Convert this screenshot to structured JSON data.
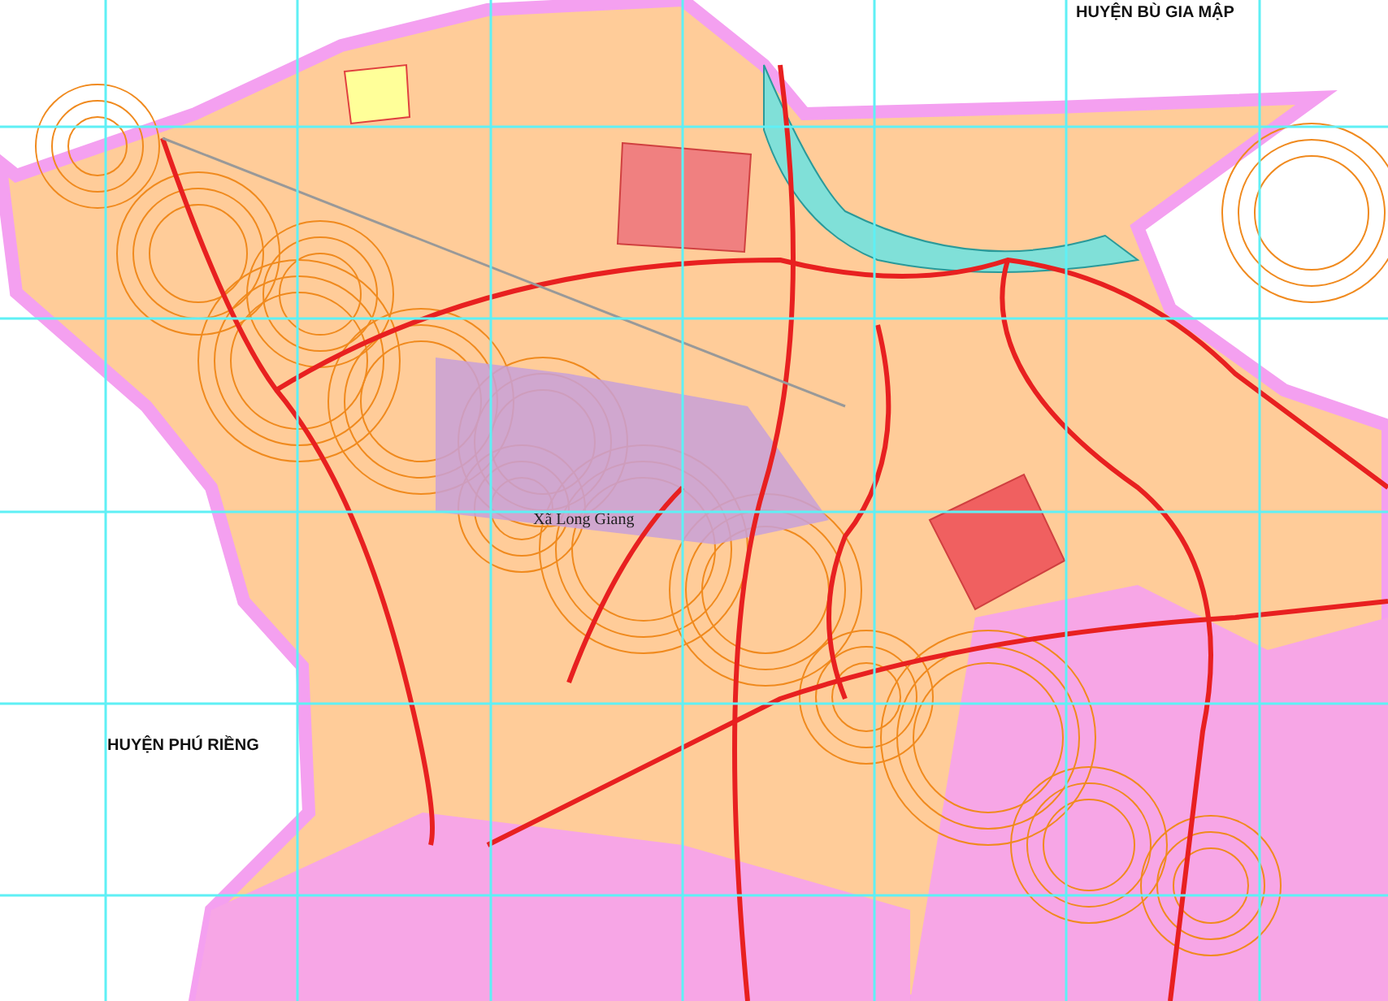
{
  "map": {
    "labels": [
      {
        "text": "HUYỆN BÙ GIA MẬP",
        "kind": "district"
      },
      {
        "text": "Xã Long Giang",
        "kind": "commune"
      },
      {
        "text": "HUYỆN PHÚ RIỀNG",
        "kind": "district"
      }
    ]
  }
}
